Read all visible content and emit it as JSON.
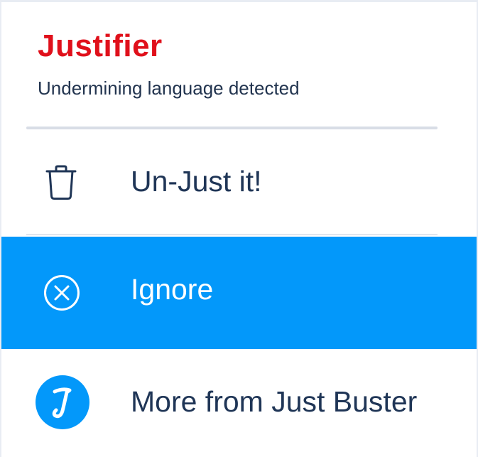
{
  "header": {
    "title": "Justifier",
    "subtitle": "Undermining language detected"
  },
  "menu": {
    "items": [
      {
        "label": "Un-Just it!",
        "icon": "trash-icon",
        "selected": false
      },
      {
        "label": "Ignore",
        "icon": "close-circle-icon",
        "selected": true
      },
      {
        "label": "More from Just Buster",
        "icon": "just-buster-logo-icon",
        "selected": false
      }
    ]
  },
  "logo": {
    "glyph": "J"
  },
  "colors": {
    "title": "#e0101b",
    "text": "#1f3556",
    "selected_background": "#0398fa",
    "selected_text": "#ffffff",
    "logo_background": "#0398fa"
  }
}
